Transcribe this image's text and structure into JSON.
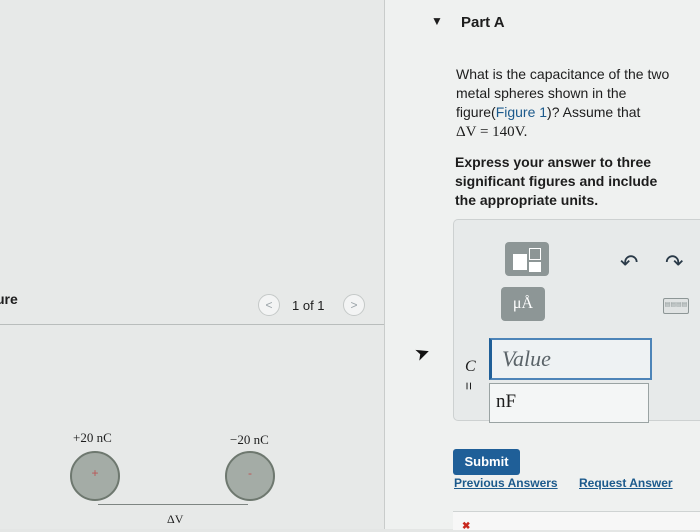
{
  "figure": {
    "title": "ure",
    "prev_icon": "<",
    "next_icon": ">",
    "page_counter": "1 of 1",
    "left_charge": "+20 nC",
    "right_charge": "−20 nC",
    "left_sign": "+",
    "right_sign": "-",
    "delta_v": "ΔV"
  },
  "part": {
    "caret": "▼",
    "title": "Part A",
    "question_pre": "What is the capacitance of the two metal spheres shown in the figure(",
    "figure_link": "Figure 1",
    "question_post": ")? Assume that",
    "question_math": "ΔV = 140V.",
    "instruction": "Express your answer to three significant figures and include the appropriate units."
  },
  "answer": {
    "units_label": "μÅ",
    "undo_icon": "↶",
    "redo_icon": "↷",
    "keyboard_icon": "▤▤▤▤",
    "variable": "C",
    "equals": "=",
    "value_placeholder": "Value",
    "unit_value": "nF"
  },
  "actions": {
    "submit": "Submit",
    "previous_answers": "Previous Answers",
    "request_answer": "Request Answer"
  },
  "colors": {
    "accent": "#1f5f98",
    "link": "#1c5a8c",
    "error": "#c8281e"
  }
}
